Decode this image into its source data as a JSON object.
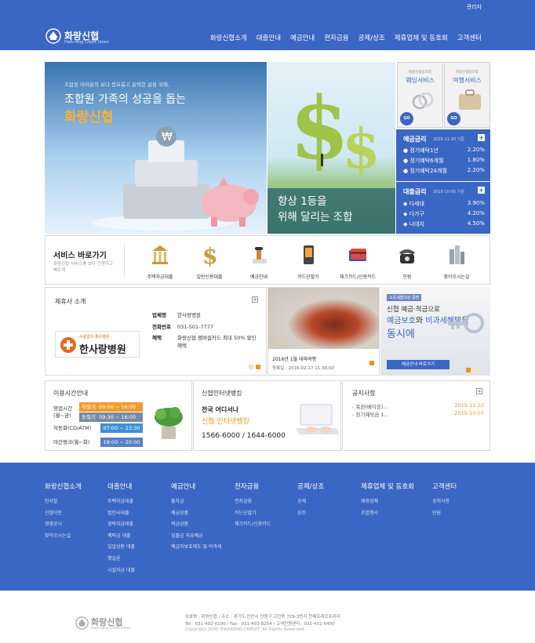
{
  "header": {
    "admin_link": "관리자",
    "logo_name": "화랑신협",
    "logo_sub": "Hwa-rang Credit Union",
    "nav": [
      "화랑신협소개",
      "대출안내",
      "예금안내",
      "전자금융",
      "공제/상조",
      "제휴업체 및 동호회",
      "고객센터"
    ]
  },
  "hero": {
    "line1": "조합원 여러분의 보다 풍요롭고 윤택한 삶을 위해,",
    "line2": "조합원 가족의 성공을 돕는",
    "line3": "화랑신협",
    "caption_line1": "항상 1등을",
    "caption_line2": "위해 달리는 조합"
  },
  "side_services": [
    {
      "small": "화랑신협동조합",
      "title": "웨딩서비스",
      "go": "GO"
    },
    {
      "small": "화랑신협동조합",
      "title": "여행서비스",
      "go": "GO"
    }
  ],
  "deposit_rates": {
    "title": "예금금리",
    "date": "2015-11-10 기준",
    "rows": [
      {
        "label": "● 정기예탁1년",
        "value": "2.20%"
      },
      {
        "label": "● 정기예탁6개월",
        "value": "1.80%"
      },
      {
        "label": "● 정기예탁24개월",
        "value": "2.20%"
      }
    ]
  },
  "loan_rates": {
    "title": "대출금리",
    "date": "2015-10-05 기준",
    "rows": [
      {
        "label": "◆ 다세대",
        "value": "3.90%"
      },
      {
        "label": "◆ 다가구",
        "value": "4.20%"
      },
      {
        "label": "◆ 나대지",
        "value": "4.50%"
      }
    ]
  },
  "quick": {
    "title": "서비스 바로가기",
    "desc": "화랑신협 서비스를 보다 간편하고 빠르게",
    "items": [
      "주택자금대출",
      "일반신용대출",
      "예금안내",
      "카드단말기",
      "체크카드/신용카드",
      "민원",
      "찾아오시는길"
    ]
  },
  "partner": {
    "title": "제휴사 소개",
    "hospital_small": "수술없이 좋은병원",
    "hospital_name": "한사랑병원",
    "rows": [
      {
        "k": "업체명",
        "v": "한사랑병원"
      },
      {
        "k": "전화번호",
        "v": "031-501-7777"
      },
      {
        "k": "혜택",
        "v": "화랑신협 멤버쉽카드 최대 50% 할인 혜택"
      }
    ]
  },
  "photo": {
    "title": "2016년 1월 데마여행",
    "date": "등록일 : 2016-02-17 11:38:00"
  },
  "banner": {
    "tag": "소득세법대상 증명",
    "line1": "신협 예금·적금으로",
    "line2a": "예금보호",
    "line2b": "와 ",
    "line2c": "비과세혜택",
    "line2d": "을",
    "line3": "동시에",
    "button": "예금안내 바로가기"
  },
  "hours": {
    "title": "이용시간안내",
    "label1": "영업시간",
    "label1b": "(월~금)",
    "summer_tag": "하절기",
    "summer": "09:00 ~ 16:00",
    "winter_tag": "동절기",
    "winter": "09:30 ~ 16:00",
    "atm_label": "자동화(CD/ATM)",
    "atm": "07:00 ~ 23:30",
    "night_label": "야간뱅크(월~화)",
    "night": "18:00 ~ 20:00"
  },
  "netbank": {
    "title": "신협인터넷뱅킹",
    "line1": "전국 어디서나",
    "line2": "신협 인터넷뱅킹",
    "phone": "1566-6000 / 1644-6000"
  },
  "notice": {
    "title": "공지사항",
    "rows": [
      {
        "t": "- 복권(베이징)...",
        "d": "2015-11-10"
      },
      {
        "t": "- 정기예탁금 1...",
        "d": "2015-10-07"
      }
    ]
  },
  "footer_nav": [
    {
      "head": "화랑신협소개",
      "items": [
        "인사말",
        "신협이란",
        "경영공시",
        "찾아오시는길"
      ]
    },
    {
      "head": "대출안내",
      "items": [
        "주택자금대출",
        "법인사대출",
        "경락자금대출",
        "예탁금 대출",
        "일일상환 대출",
        "햇살론",
        "시설자금 대출"
      ]
    },
    {
      "head": "예금안내",
      "items": [
        "출자금",
        "예금상품",
        "적금상품",
        "입출금 자유예금",
        "예금자보호제도 및 비과세"
      ]
    },
    {
      "head": "전자금융",
      "items": [
        "전자금융",
        "카드단말기",
        "체크카드/신용카드"
      ]
    },
    {
      "head": "공제/상조",
      "items": [
        "공제",
        "상조"
      ]
    },
    {
      "head": "제휴업체 및 동호회",
      "items": [
        "제휴업체",
        "조합행사"
      ]
    },
    {
      "head": "고객센터",
      "items": [
        "공지사항",
        "민원"
      ]
    }
  ],
  "copyright": {
    "logo_name": "화랑신협",
    "logo_sub": "Hwa-rang Credit Union",
    "line1": "상호명 : 화랑신협 / 주소 : 경기도 안산시 단원구 고잔동 729-3번지 천혜프레르프라자",
    "line2": "Tel : 031-492-0100 / Fax : 031-403-8254 / 고객민원센터 : 031-411-5400",
    "line3": "Copyright 2005 HWARANG CREDIT. All Rights Reserved."
  }
}
